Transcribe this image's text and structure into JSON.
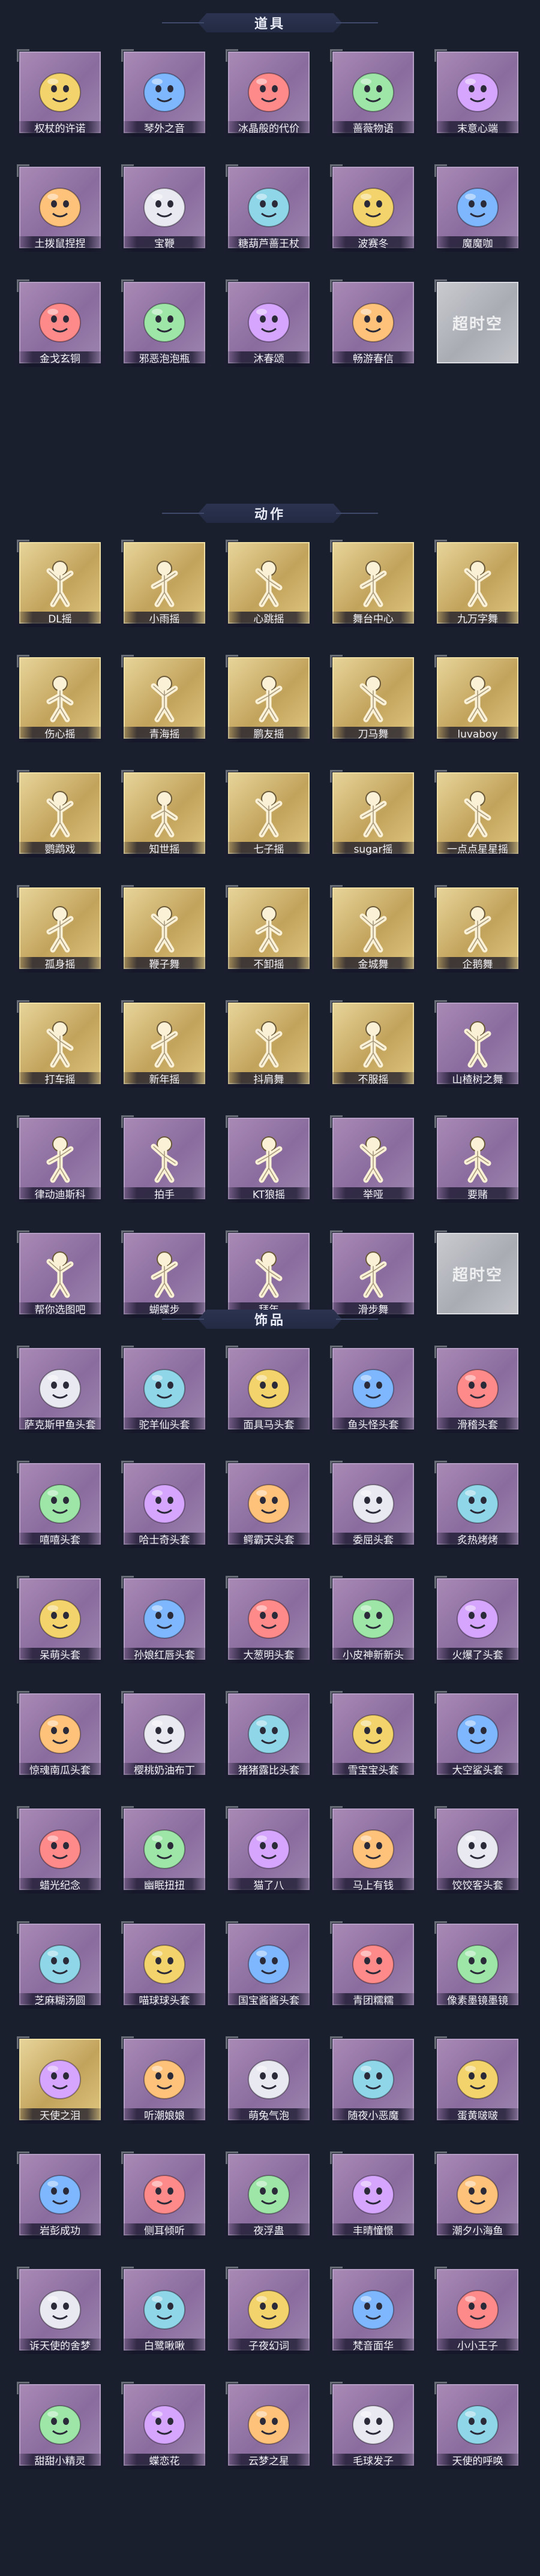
{
  "sections": [
    {
      "title": "道具",
      "items": [
        {
          "label": "权杖的许诺",
          "style": "purple",
          "icon": "scepter-icon"
        },
        {
          "label": "琴外之音",
          "style": "purple",
          "icon": "pipa-icon"
        },
        {
          "label": "冰晶般的代价",
          "style": "purple",
          "icon": "ice-flower-icon"
        },
        {
          "label": "蔷薇物语",
          "style": "purple",
          "icon": "red-box-icon"
        },
        {
          "label": "末意心端",
          "style": "purple",
          "icon": "staff-icon"
        },
        {
          "label": "土拨鼠捏捏",
          "style": "purple",
          "icon": "groundhog-icon"
        },
        {
          "label": "宝鞭",
          "style": "purple",
          "icon": "whip-icon"
        },
        {
          "label": "糖葫芦蔷王杖",
          "style": "purple",
          "icon": "candy-staff-icon"
        },
        {
          "label": "波赛冬",
          "style": "purple",
          "icon": "trident-icon"
        },
        {
          "label": "魔魔咖",
          "style": "purple",
          "icon": "witch-icon"
        },
        {
          "label": "金戈玄铜",
          "style": "purple",
          "icon": "bronze-icon"
        },
        {
          "label": "邪恶泡泡瓶",
          "style": "purple",
          "icon": "potion-icon"
        },
        {
          "label": "沐春颂",
          "style": "purple",
          "icon": "flower-wand-icon"
        },
        {
          "label": "畅游春信",
          "style": "purple",
          "icon": "fan-icon"
        },
        {
          "label": "",
          "style": "grey",
          "icon": "",
          "placeholder": "超时空"
        }
      ]
    },
    {
      "title": "动作",
      "items": [
        {
          "label": "DL摇",
          "style": "gold",
          "icon": "dance-pose-icon"
        },
        {
          "label": "小雨摇",
          "style": "gold",
          "icon": "dance-pose-icon"
        },
        {
          "label": "心跳摇",
          "style": "gold",
          "icon": "dance-pose-icon"
        },
        {
          "label": "舞台中心",
          "style": "gold",
          "icon": "dance-pose-icon"
        },
        {
          "label": "九万字舞",
          "style": "gold",
          "icon": "dance-pose-icon"
        },
        {
          "label": "伤心摇",
          "style": "gold",
          "icon": "dance-pose-icon"
        },
        {
          "label": "青海摇",
          "style": "gold",
          "icon": "dance-pose-icon"
        },
        {
          "label": "鹏友摇",
          "style": "gold",
          "icon": "dance-pose-icon"
        },
        {
          "label": "刀马舞",
          "style": "gold",
          "icon": "dance-pose-icon"
        },
        {
          "label": "luvaboy",
          "style": "gold",
          "icon": "dance-pose-icon"
        },
        {
          "label": "鹦鹉戏",
          "style": "gold",
          "icon": "dance-pose-icon"
        },
        {
          "label": "知世摇",
          "style": "gold",
          "icon": "dance-pose-icon"
        },
        {
          "label": "七子摇",
          "style": "gold",
          "icon": "dance-pose-icon"
        },
        {
          "label": "sugar摇",
          "style": "gold",
          "icon": "dance-pose-icon"
        },
        {
          "label": "一点点星星摇",
          "style": "gold",
          "icon": "dance-pose-icon"
        },
        {
          "label": "孤身摇",
          "style": "gold",
          "icon": "dance-pose-icon"
        },
        {
          "label": "鞭子舞",
          "style": "gold",
          "icon": "dance-pose-icon"
        },
        {
          "label": "不卸摇",
          "style": "gold",
          "icon": "dance-pose-icon"
        },
        {
          "label": "金城舞",
          "style": "gold",
          "icon": "dance-pose-icon"
        },
        {
          "label": "企鹅舞",
          "style": "gold",
          "icon": "dance-pose-icon"
        },
        {
          "label": "打车摇",
          "style": "gold",
          "icon": "dance-pose-icon"
        },
        {
          "label": "新年摇",
          "style": "gold",
          "icon": "dance-pose-icon"
        },
        {
          "label": "抖肩舞",
          "style": "gold",
          "icon": "dance-pose-icon"
        },
        {
          "label": "不服摇",
          "style": "gold",
          "icon": "dance-pose-icon"
        },
        {
          "label": "山楂树之舞",
          "style": "purple",
          "icon": "dance-pose-icon"
        },
        {
          "label": "律动迪斯科",
          "style": "purple",
          "icon": "dance-pose-icon"
        },
        {
          "label": "拍手",
          "style": "purple",
          "icon": "dance-pose-icon"
        },
        {
          "label": "KT狼摇",
          "style": "purple",
          "icon": "dance-pose-icon"
        },
        {
          "label": "举哑",
          "style": "purple",
          "icon": "dance-pose-icon"
        },
        {
          "label": "要赌",
          "style": "purple",
          "icon": "dance-pose-icon"
        },
        {
          "label": "帮你选图吧",
          "style": "purple",
          "icon": "dance-pose-icon"
        },
        {
          "label": "蝴蝶步",
          "style": "purple",
          "icon": "dance-pose-icon"
        },
        {
          "label": "拜年",
          "style": "purple",
          "icon": "dance-pose-icon"
        },
        {
          "label": "滑步舞",
          "style": "purple",
          "icon": "dance-pose-icon"
        },
        {
          "label": "",
          "style": "grey",
          "icon": "",
          "placeholder": "超时空"
        }
      ]
    },
    {
      "title": "饰品",
      "items": [
        {
          "label": "萨克斯甲鱼头套",
          "style": "purple",
          "icon": "fish-head-icon"
        },
        {
          "label": "驼羊仙头套",
          "style": "purple",
          "icon": "panda-head-icon"
        },
        {
          "label": "面具马头套",
          "style": "purple",
          "icon": "horse-head-icon"
        },
        {
          "label": "鱼头怪头套",
          "style": "purple",
          "icon": "fish-monster-icon"
        },
        {
          "label": "滑稽头套",
          "style": "purple",
          "icon": "smiley-icon"
        },
        {
          "label": "嘻嘻头套",
          "style": "purple",
          "icon": "grin-icon"
        },
        {
          "label": "哈士奇头套",
          "style": "purple",
          "icon": "husky-icon"
        },
        {
          "label": "鳄霸天头套",
          "style": "purple",
          "icon": "crocodile-icon"
        },
        {
          "label": "委屈头套",
          "style": "purple",
          "icon": "sad-face-icon"
        },
        {
          "label": "炙热烤烤",
          "style": "purple",
          "icon": "toast-icon"
        },
        {
          "label": "呆萌头套",
          "style": "purple",
          "icon": "dumb-face-icon"
        },
        {
          "label": "孙娘红唇头套",
          "style": "purple",
          "icon": "pikachu-icon"
        },
        {
          "label": "大葱明头套",
          "style": "purple",
          "icon": "onion-icon"
        },
        {
          "label": "小皮神新新头",
          "style": "purple",
          "icon": "creature-icon"
        },
        {
          "label": "火爆了头套",
          "style": "purple",
          "icon": "fire-icon"
        },
        {
          "label": "惊魂南瓜头套",
          "style": "purple",
          "icon": "pumpkin-icon"
        },
        {
          "label": "樱桃奶油布丁",
          "style": "purple",
          "icon": "pudding-icon"
        },
        {
          "label": "猪猪露比头套",
          "style": "purple",
          "icon": "pig-icon"
        },
        {
          "label": "雪宝宝头套",
          "style": "purple",
          "icon": "snowman-icon"
        },
        {
          "label": "大空鲨头套",
          "style": "purple",
          "icon": "shark-icon"
        },
        {
          "label": "蜡光纪念",
          "style": "purple",
          "icon": "candle-icon"
        },
        {
          "label": "幽眠扭扭",
          "style": "purple",
          "icon": "dog-icon"
        },
        {
          "label": "猫了八",
          "style": "purple",
          "icon": "garlic-icon"
        },
        {
          "label": "马上有钱",
          "style": "purple",
          "icon": "horse-icon"
        },
        {
          "label": "饺饺客头套",
          "style": "purple",
          "icon": "dumpling-icon"
        },
        {
          "label": "芝麻糊汤圆",
          "style": "purple",
          "icon": "tangyuan-icon"
        },
        {
          "label": "喵球球头套",
          "style": "purple",
          "icon": "cat-icon"
        },
        {
          "label": "国宝酱酱头套",
          "style": "purple",
          "icon": "panda-icon"
        },
        {
          "label": "青团糯糯",
          "style": "purple",
          "icon": "qingtuan-icon"
        },
        {
          "label": "像素墨镜墨镜",
          "style": "purple",
          "icon": "sunglasses-icon"
        },
        {
          "label": "天使之泪",
          "style": "gold",
          "icon": "angel-icon"
        },
        {
          "label": "听潮娘娘",
          "style": "purple",
          "icon": "wings-icon"
        },
        {
          "label": "萌兔气泡",
          "style": "purple",
          "icon": "rabbit-icon"
        },
        {
          "label": "随夜小恶魔",
          "style": "purple",
          "icon": "devil-icon"
        },
        {
          "label": "蛋黄啵啵",
          "style": "purple",
          "icon": "egg-icon"
        },
        {
          "label": "岩彭成功",
          "style": "purple",
          "icon": "lion-icon"
        },
        {
          "label": "侧耳倾听",
          "style": "purple",
          "icon": "girl-icon"
        },
        {
          "label": "夜浮蛊",
          "style": "purple",
          "icon": "spirit-icon"
        },
        {
          "label": "丰晴憧憬",
          "style": "purple",
          "icon": "robot-icon"
        },
        {
          "label": "潮夕小海鱼",
          "style": "purple",
          "icon": "blue-cat-icon"
        },
        {
          "label": "诉天使的舍梦",
          "style": "purple",
          "icon": "angel-girl-icon"
        },
        {
          "label": "白鹭啾啾",
          "style": "purple",
          "icon": "egret-icon"
        },
        {
          "label": "子夜幻词",
          "style": "purple",
          "icon": "dark-girl-icon"
        },
        {
          "label": "梵音面华",
          "style": "purple",
          "icon": "fairy-icon"
        },
        {
          "label": "小小王子",
          "style": "purple",
          "icon": "prince-icon"
        },
        {
          "label": "甜甜小精灵",
          "style": "purple",
          "icon": "elf-icon"
        },
        {
          "label": "蝶恋花",
          "style": "purple",
          "icon": "butterfly-icon"
        },
        {
          "label": "云梦之星",
          "style": "purple",
          "icon": "star-girl-icon"
        },
        {
          "label": "毛球发子",
          "style": "purple",
          "icon": "fluffy-icon"
        },
        {
          "label": "天使的呼唤",
          "style": "purple",
          "icon": "angel-call-icon"
        }
      ]
    }
  ]
}
